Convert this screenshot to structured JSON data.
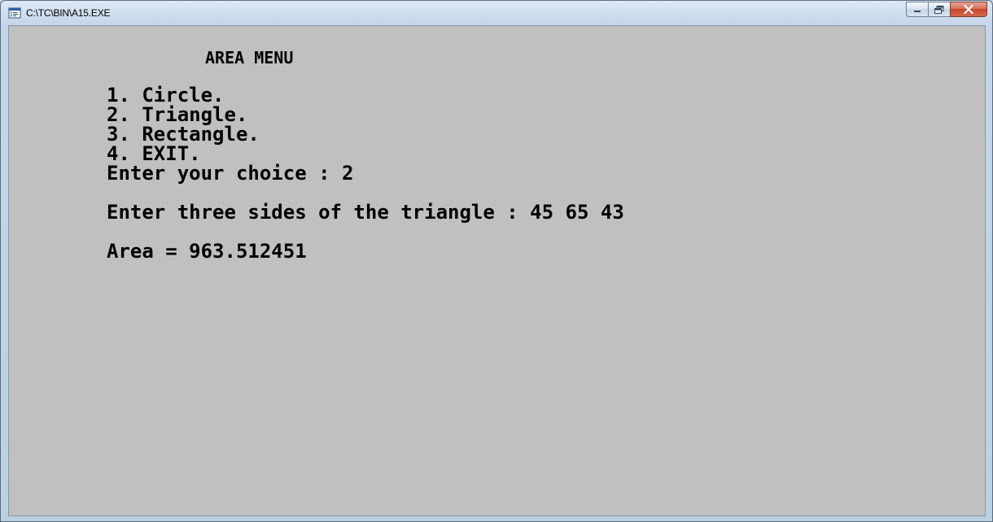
{
  "window": {
    "title": "C:\\TC\\BIN\\A15.EXE",
    "icon": "dos-program-icon",
    "buttons": {
      "minimize": "minimize-icon",
      "maximize": "maximize-icon",
      "close": "close-icon"
    }
  },
  "console": {
    "background": "#c0c0c0",
    "text_color": "#000000",
    "heading": "AREA MENU",
    "menu_items": [
      "1. Circle.",
      "2. Triangle.",
      "3. Rectangle.",
      "4. EXIT."
    ],
    "choice_prompt": "Enter your choice : 2",
    "sides_prompt": "Enter three sides of the triangle : 45 65 43",
    "result": "Area = 963.512451"
  }
}
